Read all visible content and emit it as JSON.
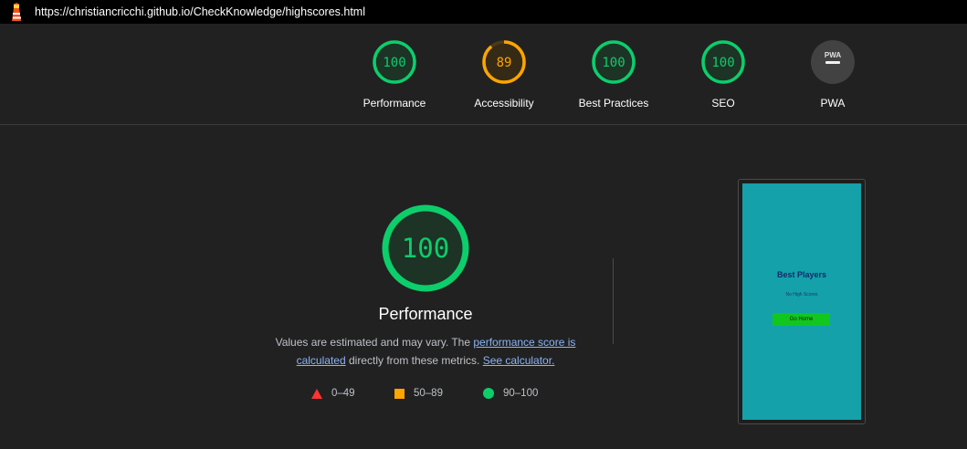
{
  "browser": {
    "url": "https://christiancricchi.github.io/CheckKnowledge/highscores.html"
  },
  "colors": {
    "pass": "#0cce6b",
    "average": "#ffa400",
    "fail": "#ff4e42",
    "na": "#9aa0a6",
    "thumbnail_bg": "#14a1a9"
  },
  "categories": [
    {
      "label": "Performance",
      "score": "100",
      "score_fraction": 1.0,
      "rating": "pass"
    },
    {
      "label": "Accessibility",
      "score": "89",
      "score_fraction": 0.89,
      "rating": "average"
    },
    {
      "label": "Best Practices",
      "score": "100",
      "score_fraction": 1.0,
      "rating": "pass"
    },
    {
      "label": "SEO",
      "score": "100",
      "score_fraction": 1.0,
      "rating": "pass"
    },
    {
      "label": "PWA",
      "icon": "pwa-badge-icon",
      "rating": "na"
    }
  ],
  "performance": {
    "score": "100",
    "title": "Performance",
    "desc_prefix": "Values are estimated and may vary. The ",
    "score_link": "performance score is calculated",
    "desc_middle": " directly from these metrics. ",
    "calc_link": "See calculator."
  },
  "legend": [
    {
      "range": "0–49",
      "icon": "triangle-icon"
    },
    {
      "range": "50–89",
      "icon": "square-icon"
    },
    {
      "range": "90–100",
      "icon": "circle-icon"
    }
  ],
  "thumbnail": {
    "title": "Best Players",
    "subtitle": "No High Scores",
    "button": "Go Home"
  }
}
